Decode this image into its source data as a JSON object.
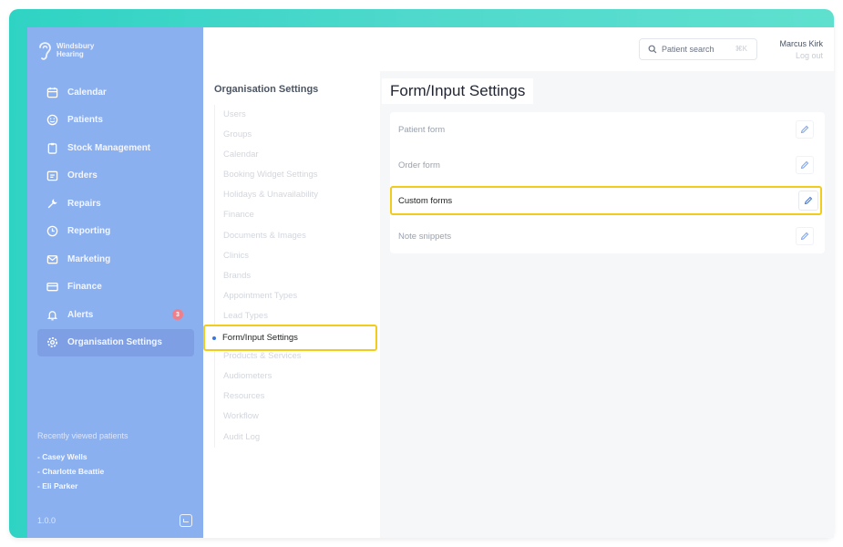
{
  "brand": {
    "line1": "Windsbury",
    "line2": "Hearing",
    "logo_icon": "ear-icon"
  },
  "sidebar": {
    "items": [
      {
        "label": "Calendar",
        "icon": "calendar-icon"
      },
      {
        "label": "Patients",
        "icon": "smile-icon"
      },
      {
        "label": "Stock Management",
        "icon": "clipboard-icon"
      },
      {
        "label": "Orders",
        "icon": "orders-icon"
      },
      {
        "label": "Repairs",
        "icon": "wrench-icon"
      },
      {
        "label": "Reporting",
        "icon": "clock-icon"
      },
      {
        "label": "Marketing",
        "icon": "mail-icon"
      },
      {
        "label": "Finance",
        "icon": "card-icon"
      },
      {
        "label": "Alerts",
        "icon": "bell-icon",
        "badge": "3"
      },
      {
        "label": "Organisation Settings",
        "icon": "gear-icon",
        "active": true
      }
    ],
    "recent_title": "Recently viewed patients",
    "recent": [
      "- Casey Wells",
      "- Charlotte Beattie",
      "- Eli Parker"
    ],
    "version": "1.0.0"
  },
  "topbar": {
    "search_placeholder": "Patient search",
    "search_shortcut": "⌘K",
    "user_name": "Marcus Kirk",
    "logout": "Log out"
  },
  "settings_nav": {
    "title": "Organisation Settings",
    "items": [
      "Users",
      "Groups",
      "Calendar",
      "Booking Widget Settings",
      "Holidays & Unavailability",
      "Finance",
      "Documents & Images",
      "Clinics",
      "Brands",
      "Appointment Types",
      "Lead Types",
      "Form/Input Settings",
      "Products & Services",
      "Audiometers",
      "Resources",
      "Workflow",
      "Audit Log"
    ],
    "active": "Form/Input Settings"
  },
  "main": {
    "title": "Form/Input Settings",
    "forms": [
      "Patient form",
      "Order form",
      "Custom forms",
      "Note snippets"
    ],
    "highlighted": "Custom forms"
  },
  "colors": {
    "sidebar": "#8bb0f0",
    "frame": "#2fd3c4",
    "highlight": "#f2cc1c",
    "accent": "#3b74e0"
  }
}
